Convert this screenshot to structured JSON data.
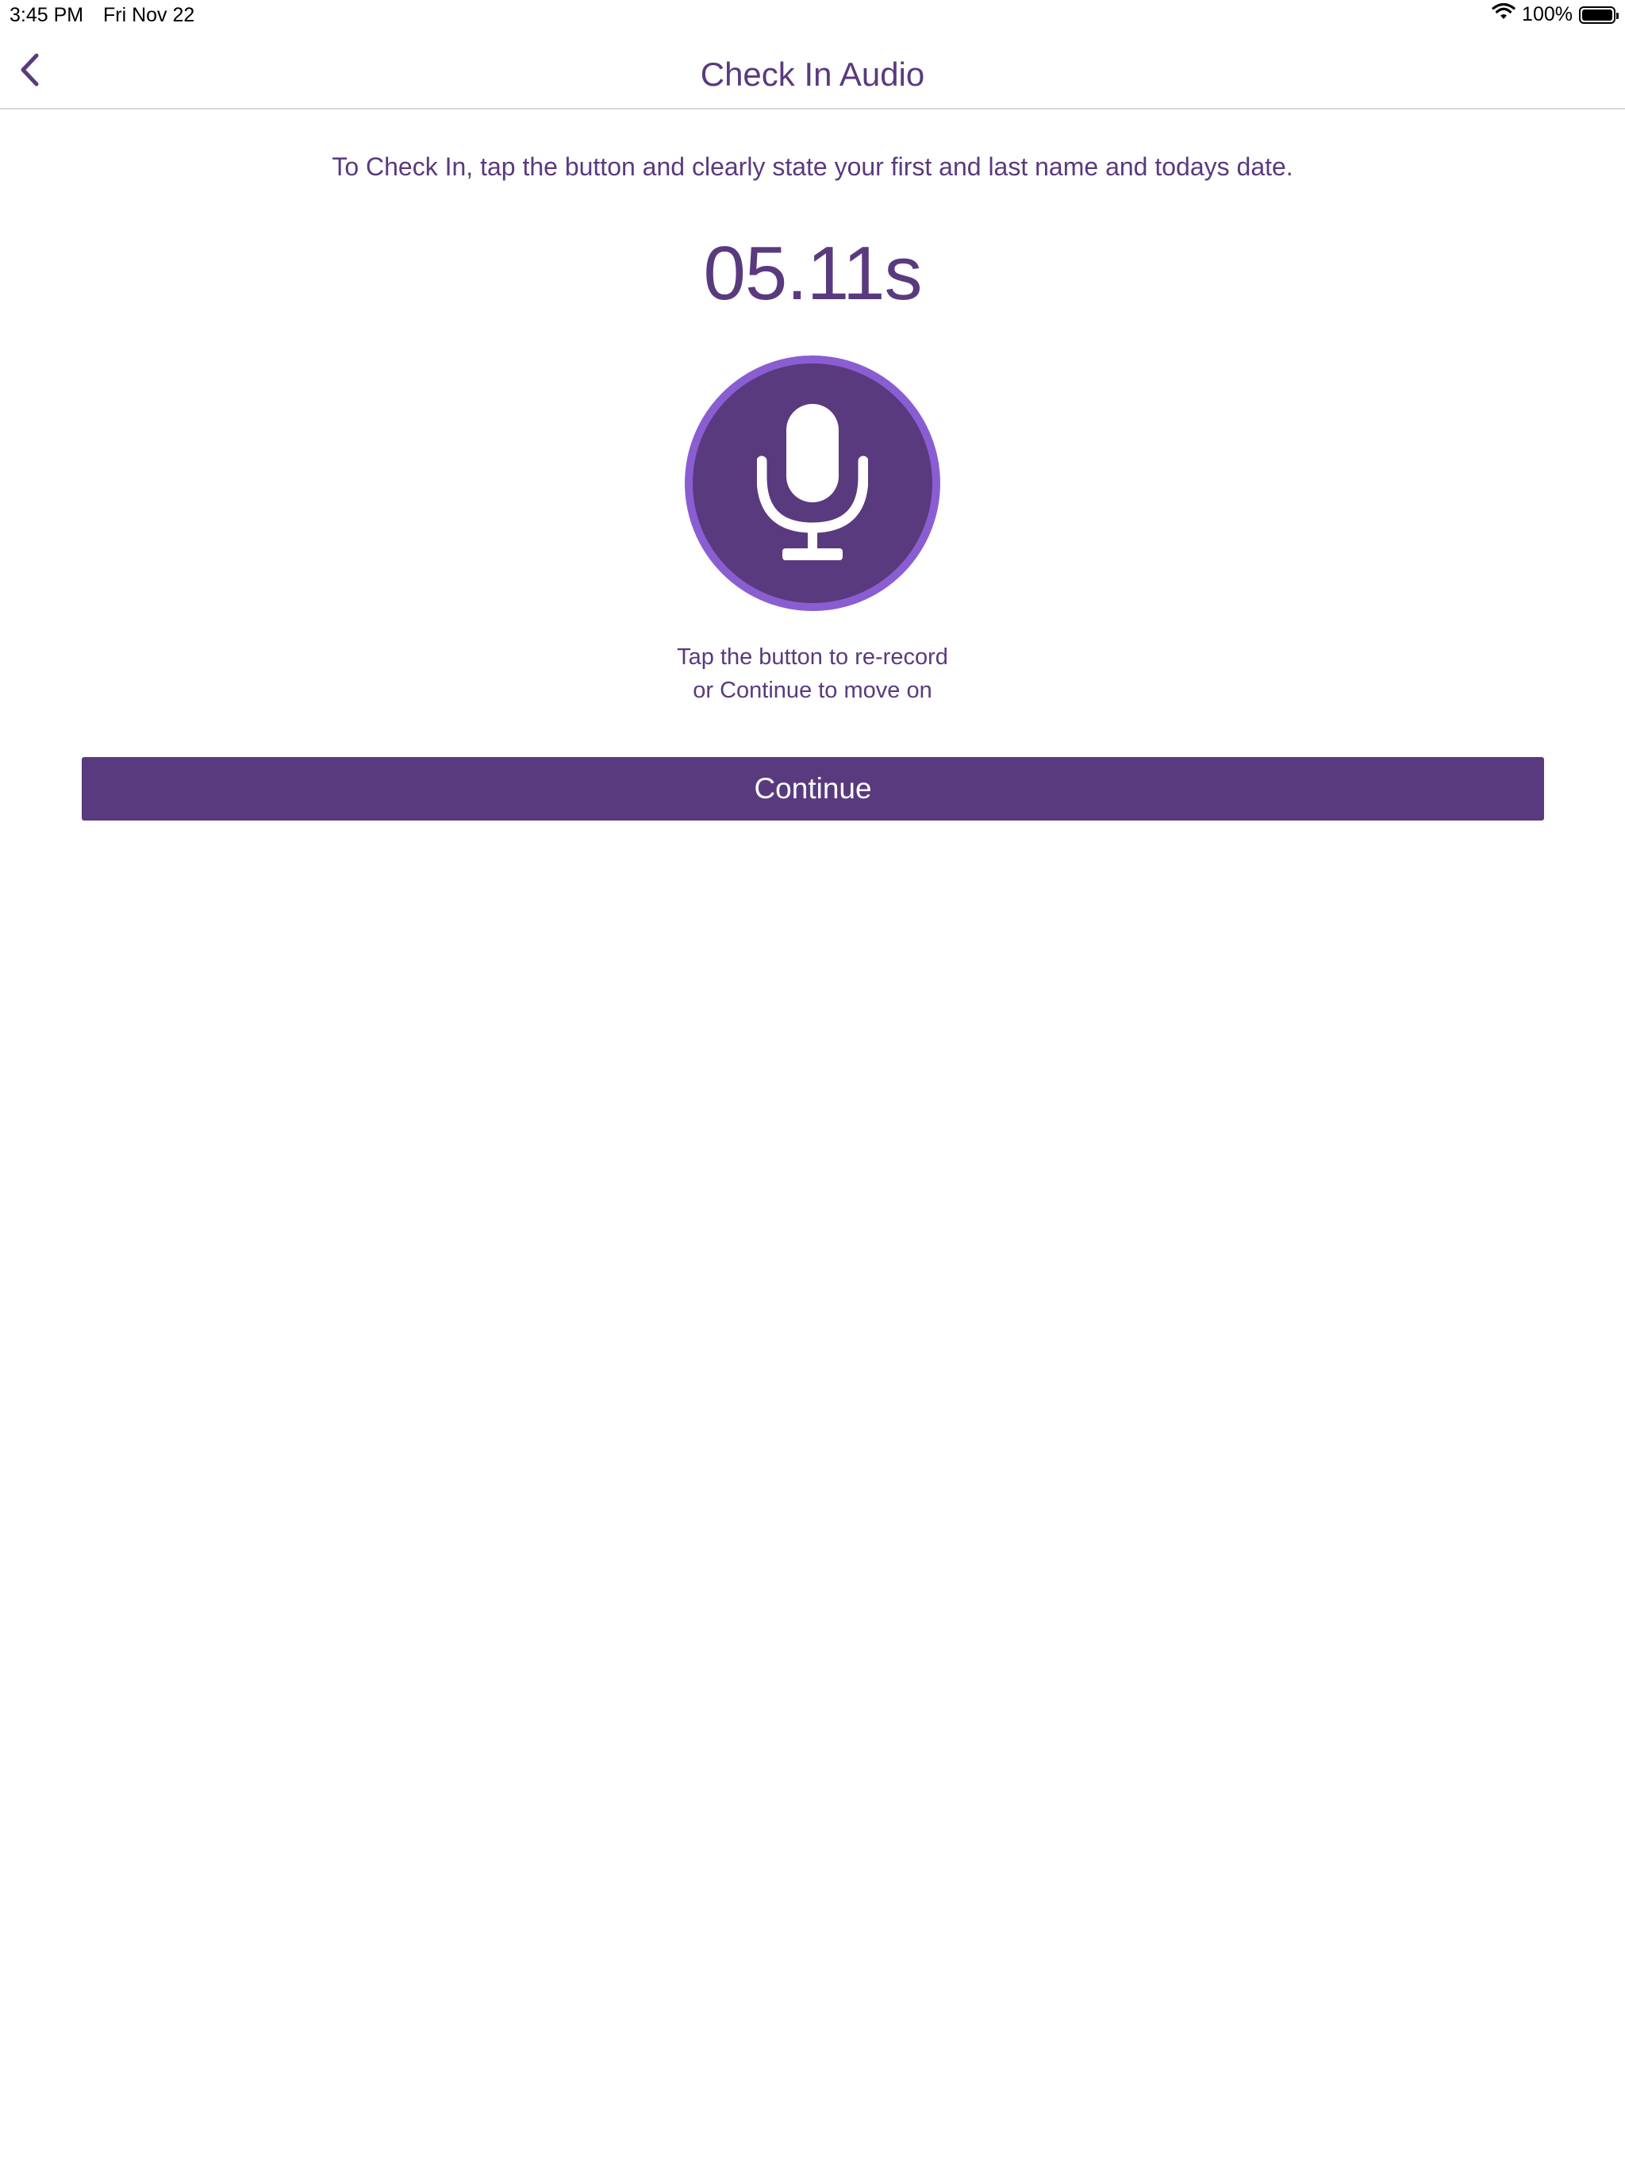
{
  "status_bar": {
    "time": "3:45 PM",
    "date": "Fri Nov 22",
    "battery_percent": "100%",
    "battery_level": 1.0,
    "wifi_icon": "wifi-icon"
  },
  "nav": {
    "title": "Check In Audio",
    "back_icon": "chevron-left-icon"
  },
  "main": {
    "instructions": "To Check In, tap the button and clearly state your first and last name and todays date.",
    "timer": "05.11s",
    "record_icon": "microphone-icon",
    "hint_line_1": "Tap the button to re-record",
    "hint_line_2": "or Continue to move on",
    "continue_label": "Continue"
  },
  "colors": {
    "accent": "#5a3a7e",
    "record_ring": "#8a5ed2",
    "background": "#ffffff"
  }
}
